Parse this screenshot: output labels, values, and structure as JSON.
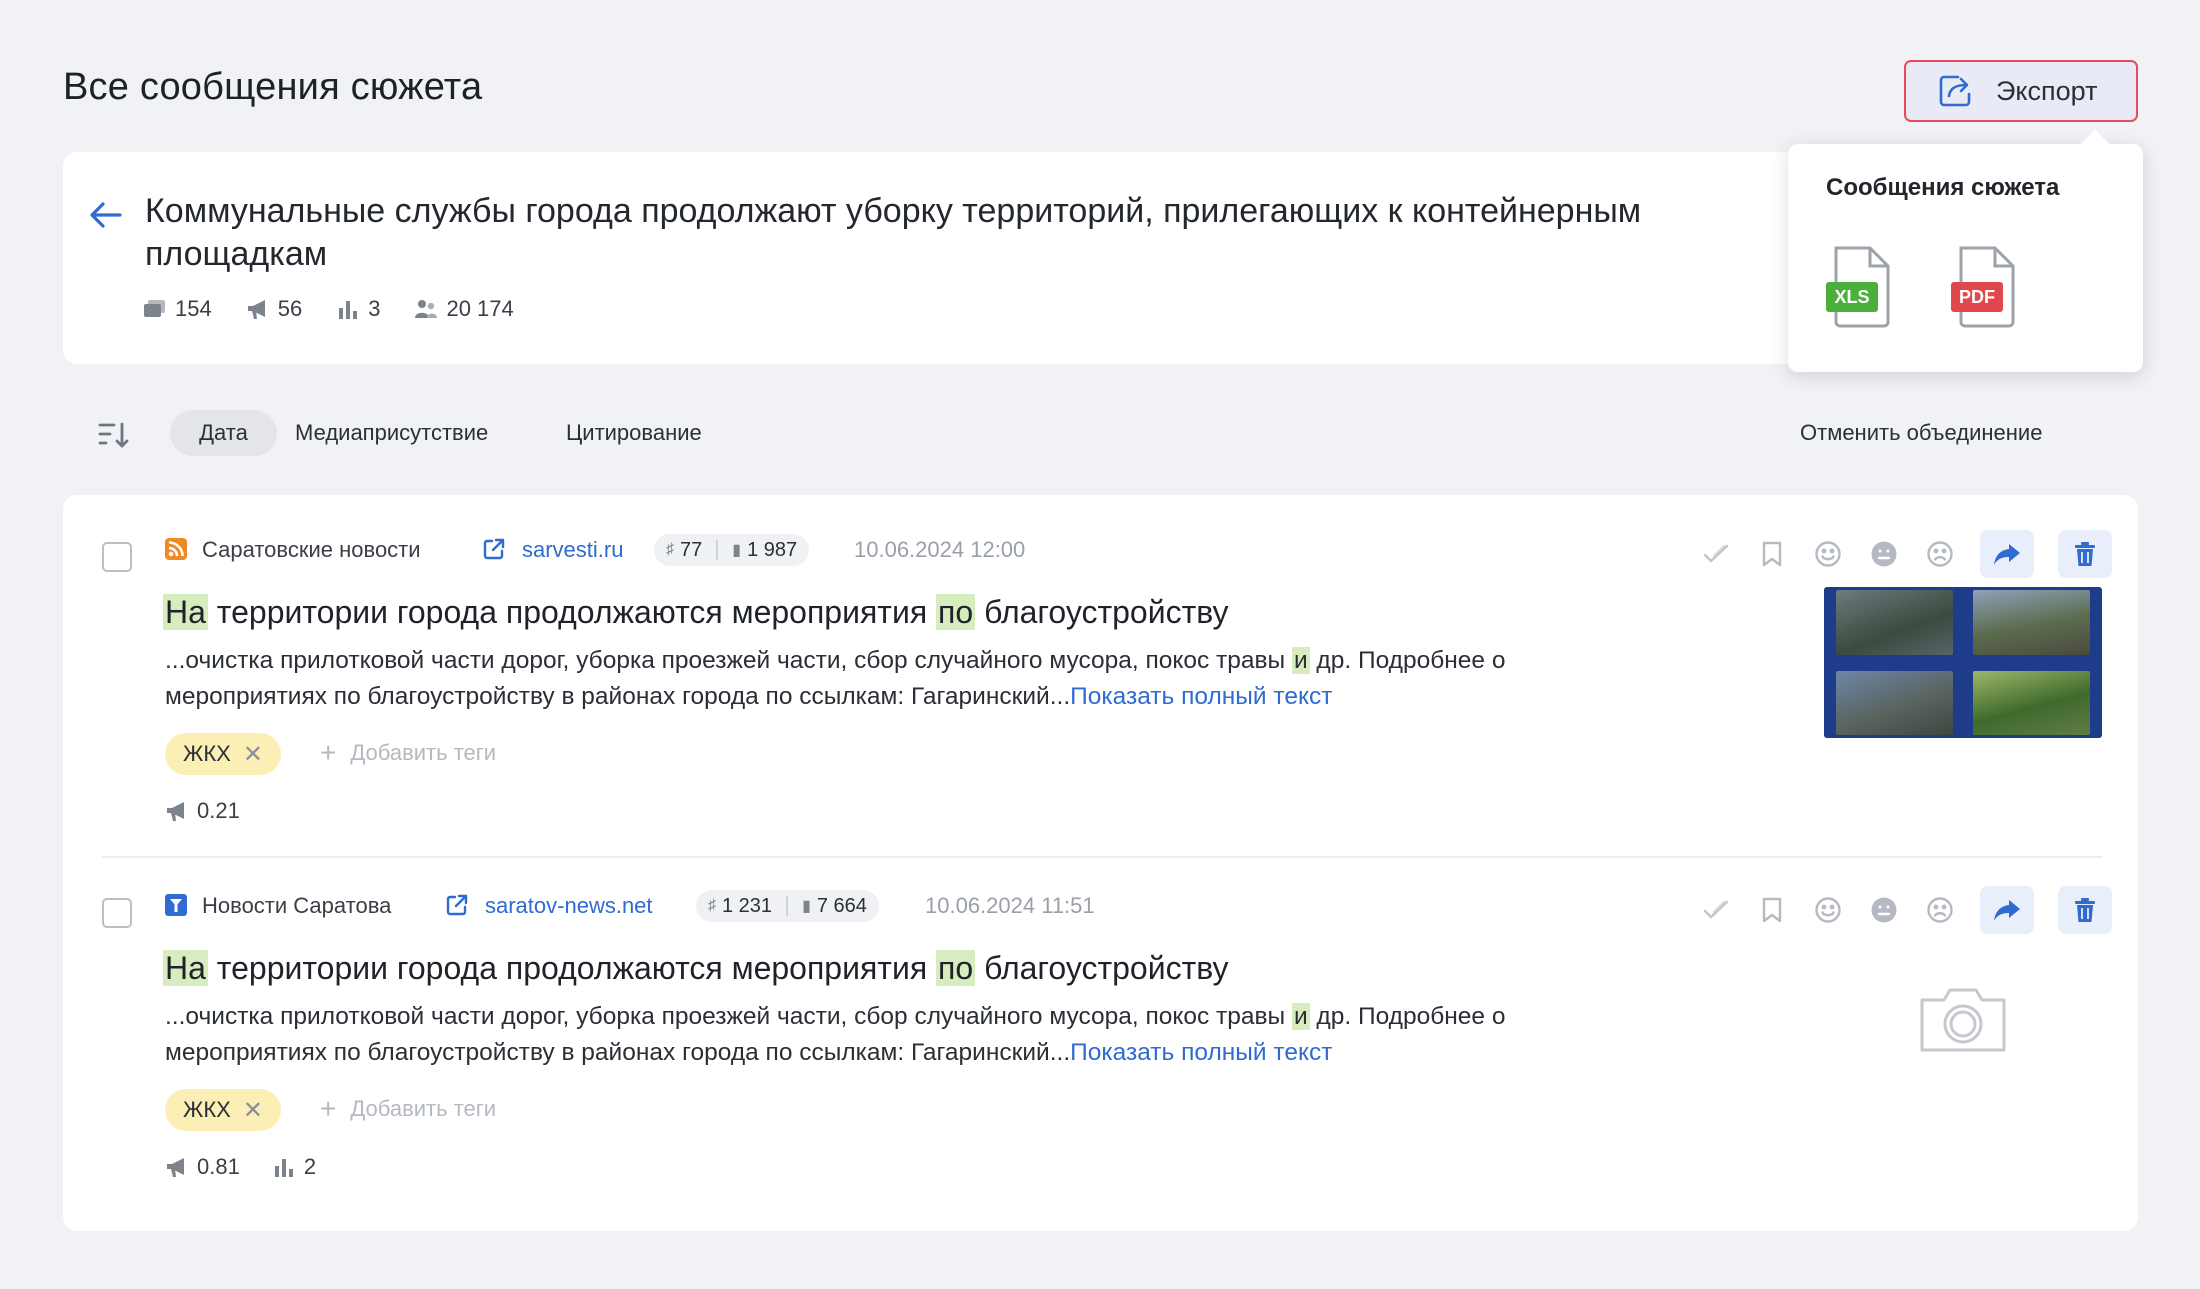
{
  "header": {
    "title": "Все сообщения сюжета",
    "export_label": "Экспорт"
  },
  "story": {
    "title": "Коммунальные службы города продолжают уборку территорий, прилегающих к контейнерным площадкам",
    "stats": {
      "messages": "154",
      "mentions": "56",
      "citations": "3",
      "audience": "20 174"
    }
  },
  "export_popover": {
    "title": "Сообщения сюжета",
    "options": [
      {
        "label": "XLS",
        "color": "#4caf3c"
      },
      {
        "label": "PDF",
        "color": "#e0484d"
      }
    ]
  },
  "sort": {
    "active": "Дата",
    "tabs": [
      "Медиаприсутствие",
      "Цитирование"
    ],
    "unmerge_label": "Отменить объединение"
  },
  "messages": [
    {
      "source_name": "Саратовские новости",
      "source_icon": "rss-icon",
      "source_icon_color": "#f08a24",
      "link": "sarvesti.ru",
      "reposts": "77",
      "views": "1 987",
      "date": "10.06.2024 12:00",
      "title_parts": [
        "На",
        " территории города продолжаются мероприятия ",
        "по",
        " благоустройству"
      ],
      "text_line1_a": "...очистка прилотковой части дорог, уборка проезжей части, сбор случайного мусора, покос травы ",
      "text_hl": "и",
      "text_line1_b": " др. Подробнее о",
      "text_line2": "мероприятиях по благоустройству в районах города по ссылкам: Гагаринский...",
      "show_full": "Показать полный текст",
      "tag": "ЖКХ",
      "add_tags": "Добавить теги",
      "media_index": "0.21",
      "citations": ""
    },
    {
      "source_name": "Новости Саратова",
      "source_icon": "news-icon",
      "source_icon_color": "#2f6bd1",
      "link": "saratov-news.net",
      "reposts": "1 231",
      "views": "7 664",
      "date": "10.06.2024 11:51",
      "title_parts": [
        "На",
        " территории города продолжаются мероприятия ",
        "по",
        " благоустройству"
      ],
      "text_line1_a": "...очистка прилотковой части дорог, уборка проезжей части, сбор случайного мусора, покос травы ",
      "text_hl": "и",
      "text_line1_b": " др. Подробнее о",
      "text_line2": "мероприятиях по благоустройству в районах города по ссылкам: Гагаринский...",
      "show_full": "Показать полный текст",
      "tag": "ЖКХ",
      "add_tags": "Добавить теги",
      "media_index": "0.81",
      "citations": "2"
    }
  ],
  "colors": {
    "accent": "#2f6bd1",
    "highlight": "#d7ecbf",
    "tag_bg": "#fbefb6",
    "export_border": "#e84a5f"
  }
}
